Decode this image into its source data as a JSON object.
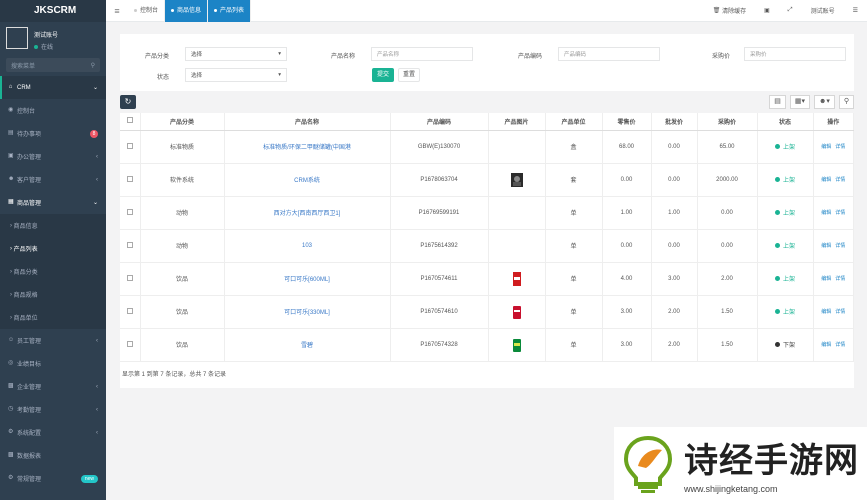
{
  "app": {
    "brand": "JKSCRM",
    "user_name": "测试账号",
    "user_status": "在线",
    "search_placeholder": "搜索菜单"
  },
  "sidebar": {
    "items": [
      {
        "label": "CRM",
        "icon": "home-icon"
      },
      {
        "label": "控制台",
        "icon": "dashboard-icon"
      },
      {
        "label": "待办事项",
        "icon": "todo-icon",
        "badge": "8"
      },
      {
        "label": "办公管理",
        "icon": "office-icon"
      },
      {
        "label": "客户管理",
        "icon": "customer-icon"
      },
      {
        "label": "商品管理",
        "icon": "goods-icon"
      },
      {
        "label": "员工管理",
        "icon": "staff-icon"
      },
      {
        "label": "业绩目标",
        "icon": "target-icon"
      },
      {
        "label": "企业管理",
        "icon": "company-icon"
      },
      {
        "label": "考勤管理",
        "icon": "attendance-icon"
      },
      {
        "label": "系统配置",
        "icon": "gear-icon"
      },
      {
        "label": "数据报表",
        "icon": "report-icon"
      },
      {
        "label": "常规管理",
        "icon": "settings-icon",
        "badge": "new"
      }
    ],
    "sub_items": [
      "商品信息",
      "产品列表",
      "商品分类",
      "商品规格",
      "商品单位"
    ]
  },
  "topbar": {
    "tabs": [
      "控制台",
      "商品信息",
      "产品列表"
    ],
    "clear_cache": "清除缓存",
    "account": "测试账号"
  },
  "filter": {
    "category_label": "产品分类",
    "category_value": "选择",
    "name_label": "产品名称",
    "name_placeholder": "产品名称",
    "code_label": "产品编码",
    "code_placeholder": "产品编码",
    "price_label": "采购价",
    "price_placeholder": "采购价",
    "status_label": "状态",
    "status_value": "选择",
    "submit": "提交",
    "reset": "重置"
  },
  "table": {
    "headers": [
      "产品分类",
      "产品名称",
      "产品编码",
      "产品图片",
      "产品单位",
      "零售价",
      "批发价",
      "采购价",
      "状态",
      "操作"
    ],
    "rows": [
      {
        "category": "标准物质",
        "name": "标准物质/环保二甲醚储罐(中国港",
        "code": "GBW(E)130070",
        "image": "",
        "unit": "盒",
        "retail": "68.00",
        "wholesale": "0.00",
        "purchase": "65.00",
        "status": "上架",
        "on": true
      },
      {
        "category": "软件系统",
        "name": "CRM系统",
        "code": "P1678063704",
        "image": "photo",
        "unit": "套",
        "retail": "0.00",
        "wholesale": "0.00",
        "purchase": "2000.00",
        "status": "上架",
        "on": true
      },
      {
        "category": "动物",
        "name": "西对方大[西南西厅西卫1]",
        "code": "P16769599191",
        "image": "",
        "unit": "单",
        "retail": "1.00",
        "wholesale": "1.00",
        "purchase": "0.00",
        "status": "上架",
        "on": true
      },
      {
        "category": "动物",
        "name": "103",
        "code": "P1675614392",
        "image": "",
        "unit": "单",
        "retail": "0.00",
        "wholesale": "0.00",
        "purchase": "0.00",
        "status": "上架",
        "on": true
      },
      {
        "category": "饮品",
        "name": "可口可乐[600ML]",
        "code": "P1670574611",
        "image": "cola-red",
        "unit": "单",
        "retail": "4.00",
        "wholesale": "3.00",
        "purchase": "2.00",
        "status": "上架",
        "on": true
      },
      {
        "category": "饮品",
        "name": "可口可乐[330ML]",
        "code": "P1670574610",
        "image": "cola-can",
        "unit": "单",
        "retail": "3.00",
        "wholesale": "2.00",
        "purchase": "1.50",
        "status": "上架",
        "on": true
      },
      {
        "category": "饮品",
        "name": "雪碧",
        "code": "P1670574328",
        "image": "sprite-can",
        "unit": "单",
        "retail": "3.00",
        "wholesale": "2.00",
        "purchase": "1.50",
        "status": "下架",
        "on": false
      }
    ],
    "op_edit": "编辑",
    "op_detail": "详情"
  },
  "footer": {
    "summary": "显示第 1 到第 7 条记录，总共 7 条记录"
  },
  "watermark": {
    "title": "诗经手游网",
    "url": "www.shijingketang.com"
  }
}
